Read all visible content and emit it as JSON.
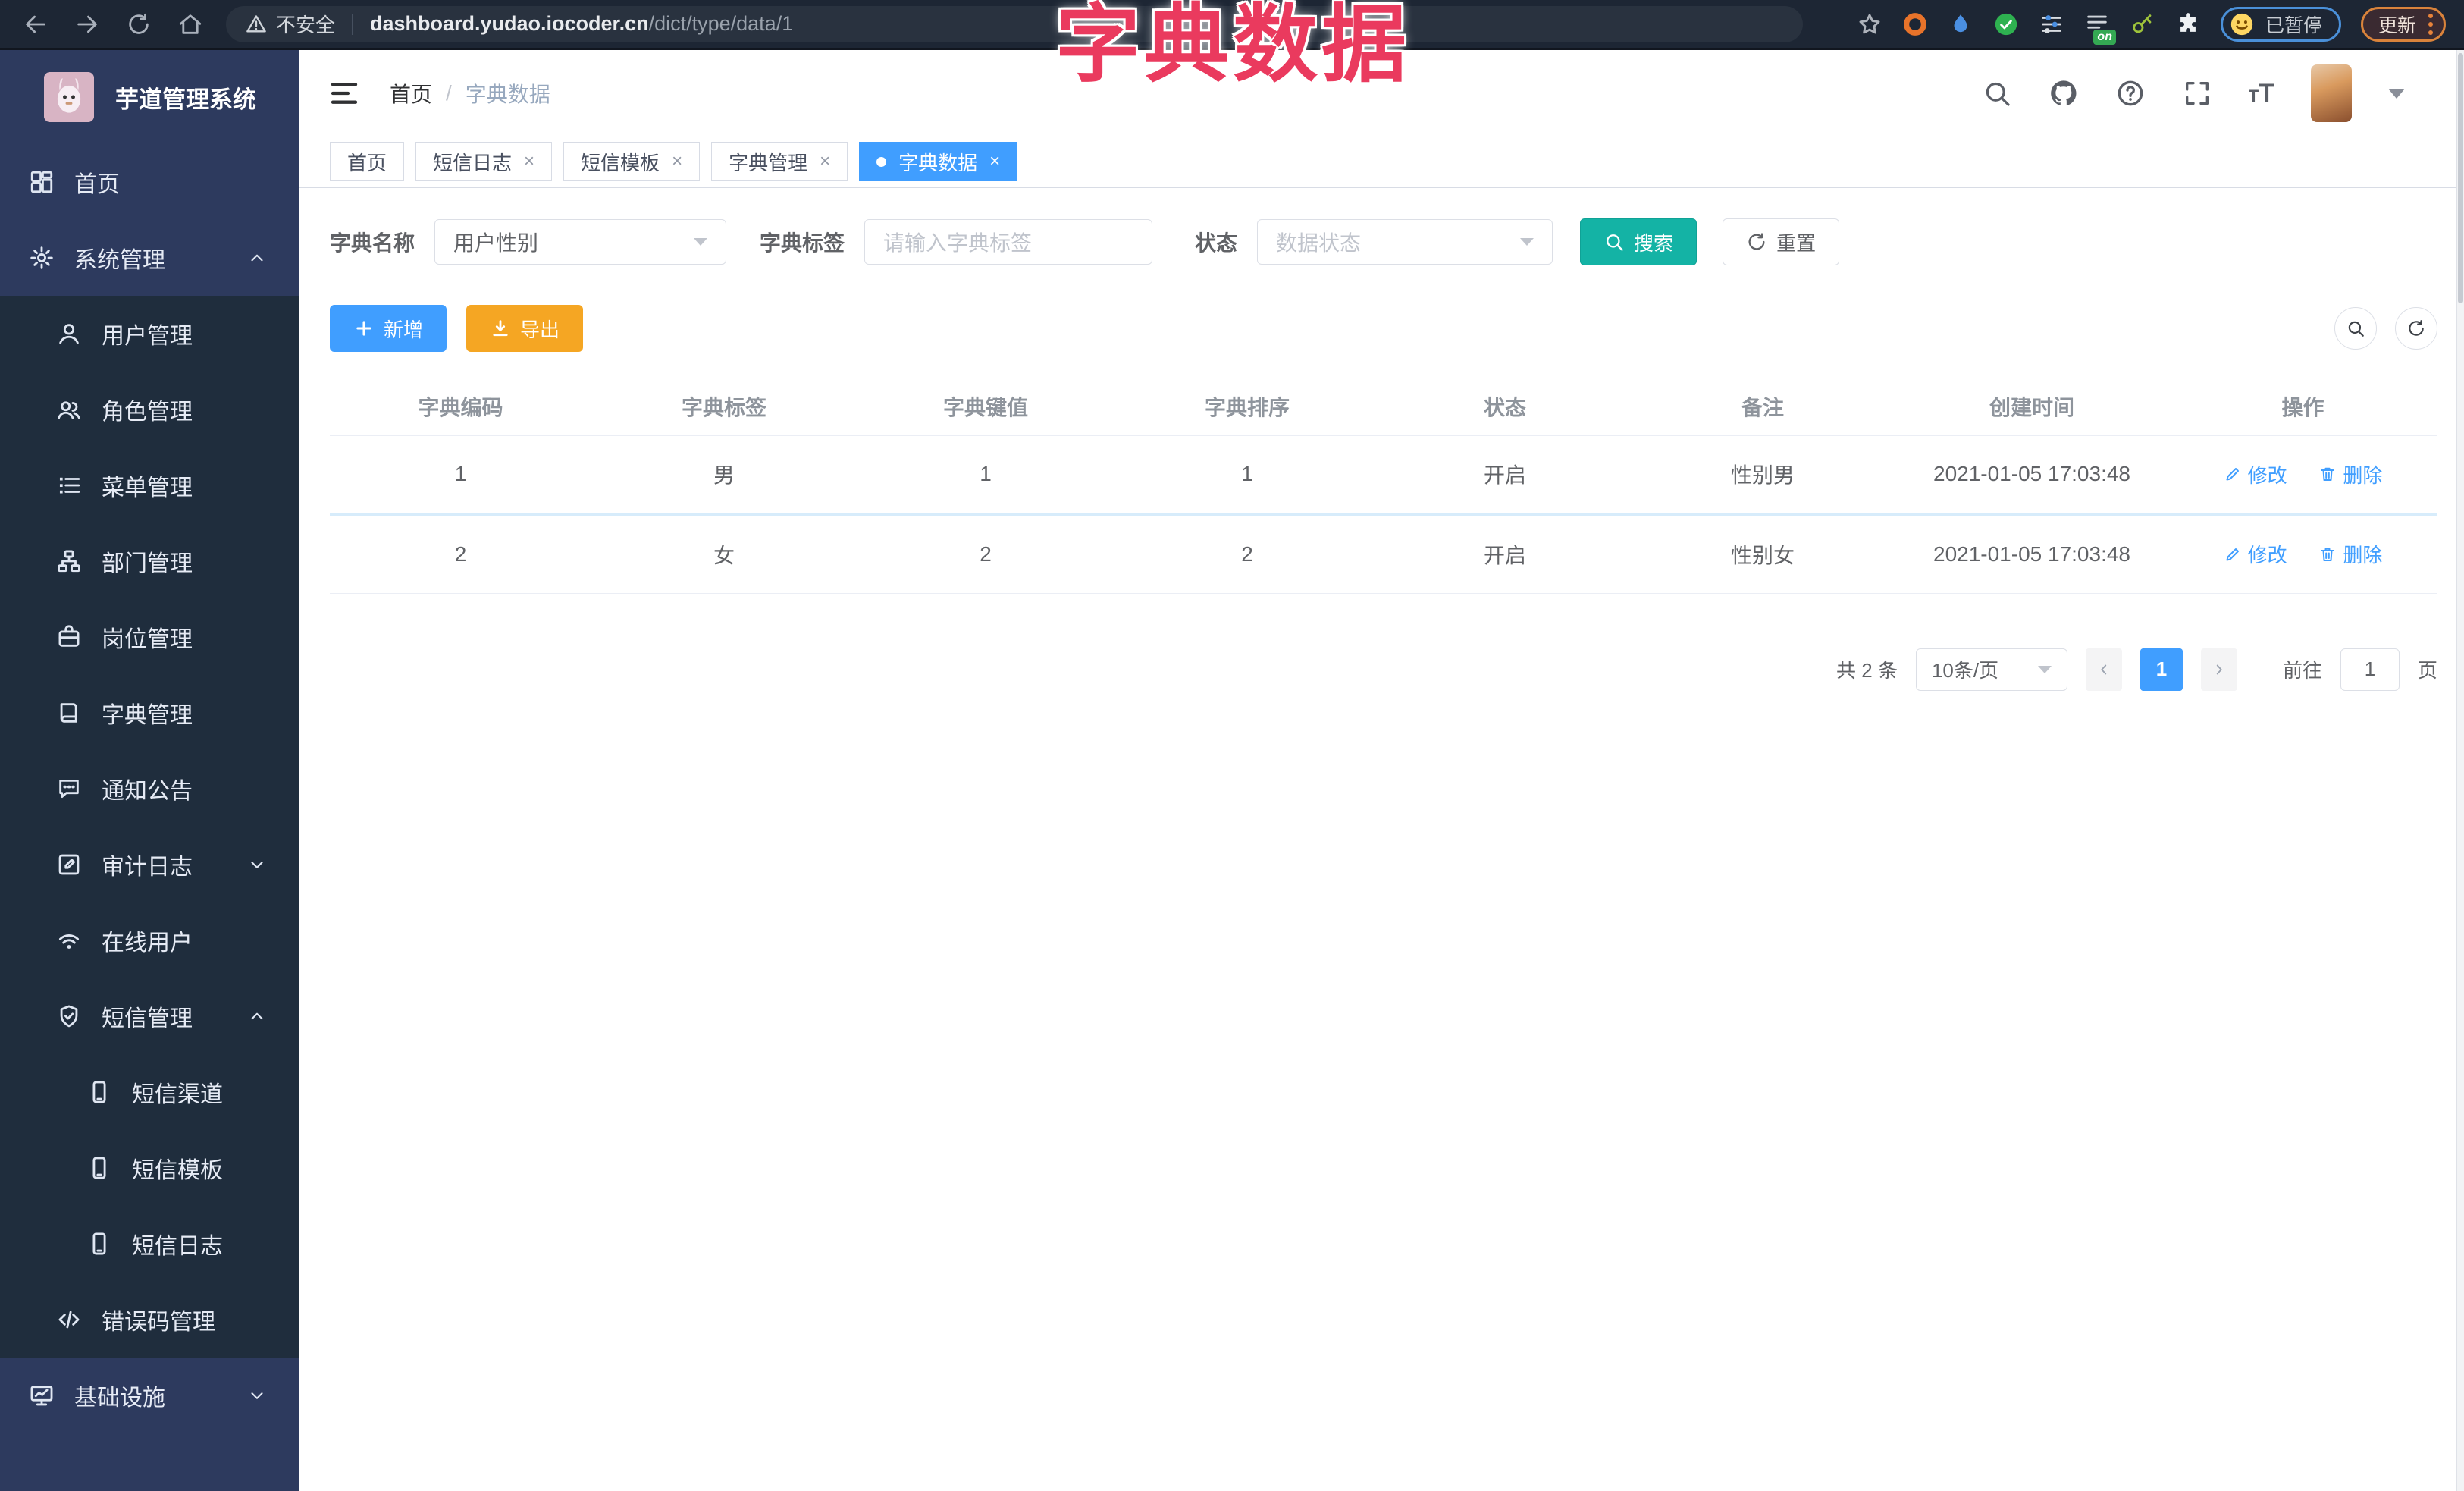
{
  "browser": {
    "security_label": "不安全",
    "url_host": "dashboard.yudao.iocoder.cn",
    "url_path": "/dict/type/data/1",
    "extension_badge": "on",
    "paused_label": "已暂停",
    "update_label": "更新"
  },
  "annotation": {
    "text": "字典数据"
  },
  "sidebar": {
    "title": "芋道管理系统",
    "items": [
      {
        "label": "首页"
      },
      {
        "label": "系统管理"
      },
      {
        "label": "用户管理"
      },
      {
        "label": "角色管理"
      },
      {
        "label": "菜单管理"
      },
      {
        "label": "部门管理"
      },
      {
        "label": "岗位管理"
      },
      {
        "label": "字典管理"
      },
      {
        "label": "通知公告"
      },
      {
        "label": "审计日志"
      },
      {
        "label": "在线用户"
      },
      {
        "label": "短信管理"
      },
      {
        "label": "短信渠道"
      },
      {
        "label": "短信模板"
      },
      {
        "label": "短信日志"
      },
      {
        "label": "错误码管理"
      },
      {
        "label": "基础设施"
      }
    ]
  },
  "header": {
    "breadcrumb_home": "首页",
    "breadcrumb_sep": "/",
    "breadcrumb_current": "字典数据"
  },
  "tabs": [
    {
      "label": "首页"
    },
    {
      "label": "短信日志"
    },
    {
      "label": "短信模板"
    },
    {
      "label": "字典管理"
    },
    {
      "label": "字典数据"
    }
  ],
  "filters": {
    "dict_name_label": "字典名称",
    "dict_name_value": "用户性别",
    "dict_label_label": "字典标签",
    "dict_label_placeholder": "请输入字典标签",
    "status_label": "状态",
    "status_placeholder": "数据状态",
    "search_button": "搜索",
    "reset_button": "重置"
  },
  "toolbar": {
    "add_button": "新增",
    "export_button": "导出"
  },
  "table": {
    "columns": [
      "字典编码",
      "字典标签",
      "字典键值",
      "字典排序",
      "状态",
      "备注",
      "创建时间",
      "操作"
    ],
    "rows": [
      {
        "code": "1",
        "label": "男",
        "value": "1",
        "sort": "1",
        "status": "开启",
        "remark": "性别男",
        "created": "2021-01-05 17:03:48"
      },
      {
        "code": "2",
        "label": "女",
        "value": "2",
        "sort": "2",
        "status": "开启",
        "remark": "性别女",
        "created": "2021-01-05 17:03:48"
      }
    ],
    "edit_label": "修改",
    "delete_label": "删除"
  },
  "pagination": {
    "total_text": "共 2 条",
    "page_size": "10条/页",
    "current_page": "1",
    "goto_label": "前往",
    "goto_value": "1",
    "page_unit": "页"
  }
}
